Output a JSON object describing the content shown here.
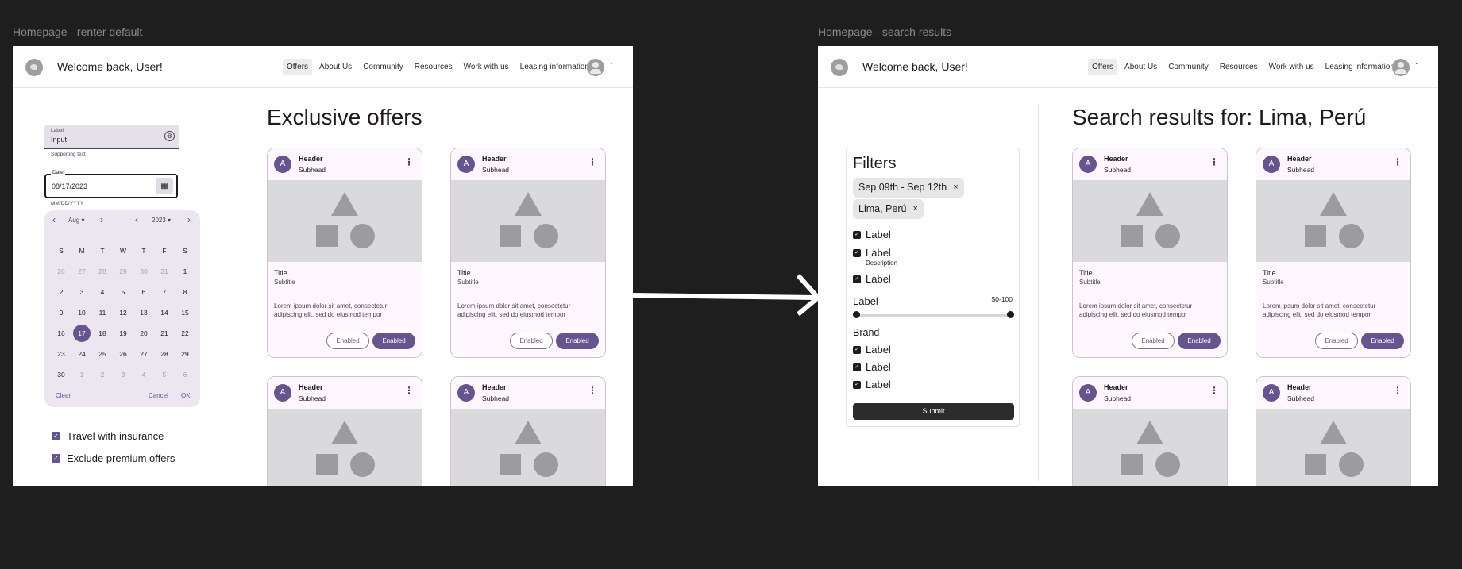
{
  "frames": {
    "left_title": "Homepage - renter default",
    "right_title": "Homepage - search results"
  },
  "topbar": {
    "welcome": "Welcome back, User!",
    "nav": [
      "Offers",
      "About Us",
      "Community",
      "Resources",
      "Work with us",
      "Leasing information"
    ],
    "caret": "⌄"
  },
  "left": {
    "heading": "Exclusive offers",
    "text_field": {
      "label": "Label",
      "value": "Input",
      "supporting": "Supporting text",
      "clear": "⊗"
    },
    "date_field": {
      "label": "Date",
      "value": "08/17/2023",
      "hint": "MM/DD/YYYY",
      "icon": "▦"
    },
    "calendar": {
      "prev": "‹",
      "next": "›",
      "month": "Aug",
      "month_caret": "▾",
      "year": "2023",
      "year_caret": "▾",
      "weekdays": [
        "S",
        "M",
        "T",
        "W",
        "T",
        "F",
        "S"
      ],
      "days": [
        "26",
        "27",
        "28",
        "29",
        "30",
        "31",
        "1",
        "2",
        "3",
        "4",
        "5",
        "6",
        "7",
        "8",
        "9",
        "10",
        "11",
        "12",
        "13",
        "14",
        "15",
        "16",
        "17",
        "18",
        "19",
        "20",
        "21",
        "22",
        "23",
        "24",
        "25",
        "26",
        "27",
        "28",
        "29",
        "30",
        "1",
        "2",
        "3",
        "4",
        "5",
        "6"
      ],
      "clear": "Clear",
      "cancel": "Cancel",
      "ok": "OK"
    },
    "checkboxes": [
      "Travel with insurance",
      "Exclude premium offers"
    ]
  },
  "right": {
    "heading": "Search results for: Lima, Perú",
    "filters": {
      "title": "Filters",
      "chips": [
        "Sep 09th - Sep 12th",
        "Lima, Perú"
      ],
      "chip_close": "×",
      "checkboxes": [
        "Label",
        "Label",
        "Label"
      ],
      "description": "Description",
      "slider_label": "Label",
      "slider_range": "$0-100",
      "brand_title": "Brand",
      "brand_checkboxes": [
        "Label",
        "Label",
        "Label"
      ],
      "submit": "Submit"
    }
  },
  "card": {
    "avatar": "A",
    "header": "Header",
    "subhead": "Subhead",
    "more": "⋮",
    "title": "Title",
    "subtitle": "Subtitle",
    "body": "Lorem ipsum dolor sit amet, consectetur adipiscing elit, sed do eiusmod tempor",
    "btn_outline": "Enabled",
    "btn_filled": "Enabled"
  },
  "colors": {
    "accent": "#65558f",
    "background": "#1e1e1e",
    "card": "#fef7ff"
  },
  "icons": {
    "check": "✓"
  }
}
